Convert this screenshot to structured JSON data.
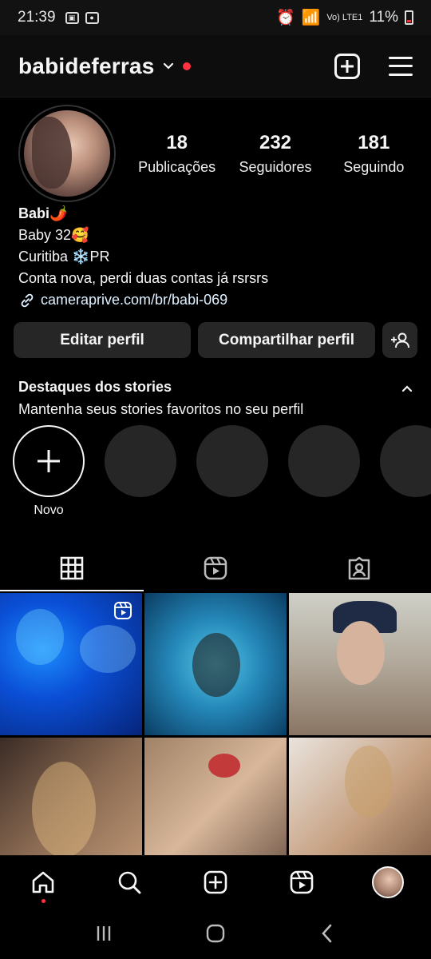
{
  "status_bar": {
    "time": "21:39",
    "network": "Vo) LTE1",
    "battery": "11%"
  },
  "header": {
    "username": "babideferras"
  },
  "profile": {
    "stats": [
      {
        "value": "18",
        "label": "Publicações"
      },
      {
        "value": "232",
        "label": "Seguidores"
      },
      {
        "value": "181",
        "label": "Seguindo"
      }
    ],
    "name": "Babi🌶️",
    "bio_lines": [
      "Baby 32🥰",
      "Curitiba ❄️PR",
      "Conta nova, perdi duas contas já rsrsrs"
    ],
    "link": "cameraprive.com/br/babi-069"
  },
  "actions": {
    "edit": "Editar perfil",
    "share": "Compartilhar perfil"
  },
  "highlights": {
    "title": "Destaques dos stories",
    "subtitle": "Mantenha seus stories favoritos no seu perfil",
    "new_label": "Novo"
  },
  "tabs": [
    "grid-icon",
    "reels-icon",
    "tagged-icon"
  ],
  "grid_posts_count": 6,
  "bottom_nav": [
    "home-icon",
    "search-icon",
    "create-icon",
    "reels-icon",
    "profile-avatar"
  ]
}
